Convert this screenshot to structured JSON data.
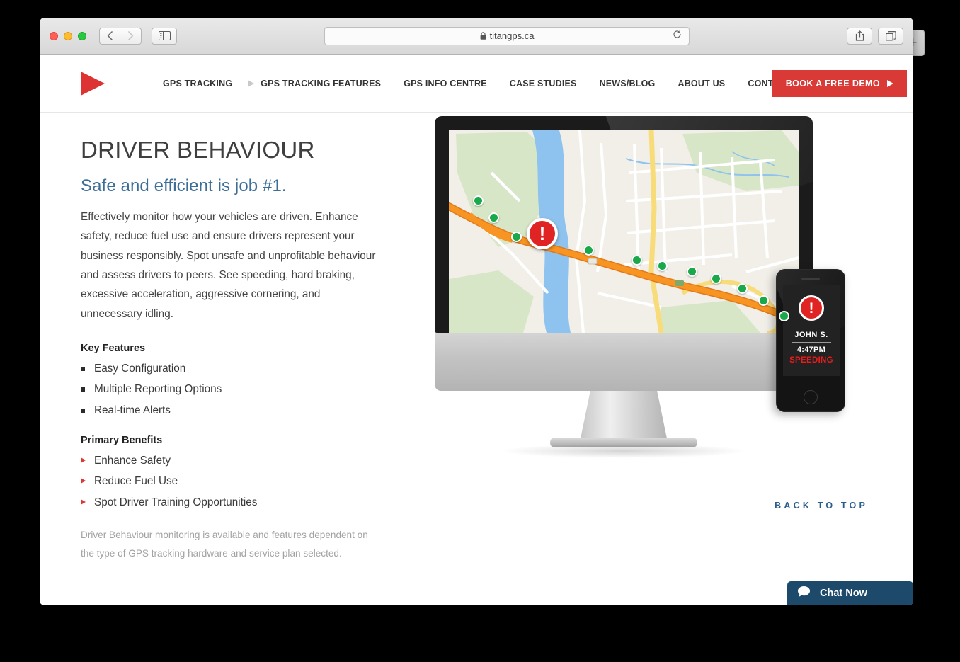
{
  "browser": {
    "url": "titangps.ca",
    "lock_icon": "lock-icon",
    "reload_icon": "reload-icon",
    "back_icon": "chevron-left-icon",
    "forward_icon": "chevron-right-icon",
    "sidebar_icon": "sidebar-toggle-icon",
    "share_icon": "share-icon",
    "tabs_icon": "show-all-tabs-icon",
    "new_tab_label": "+"
  },
  "header": {
    "logo": "titan-gps-logo",
    "nav": [
      {
        "label": "GPS TRACKING",
        "caret": false
      },
      {
        "label": "GPS TRACKING FEATURES",
        "caret": true
      },
      {
        "label": "GPS INFO CENTRE",
        "caret": false
      },
      {
        "label": "CASE STUDIES",
        "caret": false
      },
      {
        "label": "NEWS/BLOG",
        "caret": false
      },
      {
        "label": "ABOUT US",
        "caret": false
      },
      {
        "label": "CONTACT US",
        "caret": false
      }
    ],
    "search_icon": "search-icon",
    "demo_button": "BOOK A FREE DEMO"
  },
  "main": {
    "title": "DRIVER BEHAVIOUR",
    "subtitle": "Safe and efficient is job #1.",
    "body": "Effectively monitor how your vehicles are driven. Enhance safety, reduce fuel use and ensure drivers represent your business responsibly. Spot unsafe and unprofitable behaviour and assess drivers to peers. See speeding, hard braking, excessive acceleration, aggressive cornering, and unnecessary idling.",
    "key_features_heading": "Key Features",
    "key_features": [
      "Easy Configuration",
      "Multiple Reporting Options",
      "Real-time Alerts"
    ],
    "benefits_heading": "Primary Benefits",
    "benefits": [
      "Enhance Safety",
      "Reduce Fuel Use",
      "Spot Driver Training Opportunities"
    ],
    "disclaimer": "Driver Behaviour monitoring is available and features dependent on the type of GPS tracking hardware and service plan selected."
  },
  "device_mockup": {
    "map_alert_icon": "alert-exclamation-icon",
    "phone": {
      "driver_name": "JOHN S.",
      "time": "4:47PM",
      "status": "SPEEDING",
      "alert_icon": "alert-exclamation-icon"
    }
  },
  "footer": {
    "back_to_top": "BACK TO TOP",
    "chat_label": "Chat Now",
    "chat_icon": "chat-bubble-icon"
  },
  "colors": {
    "brand_red": "#d93a35",
    "accent_blue": "#3d6e96",
    "link_blue": "#2c5e8c",
    "chat_blue": "#1d4a6b",
    "alert_red": "#e02424",
    "waypoint_green": "#19a84a",
    "route_orange": "#f08c28"
  }
}
